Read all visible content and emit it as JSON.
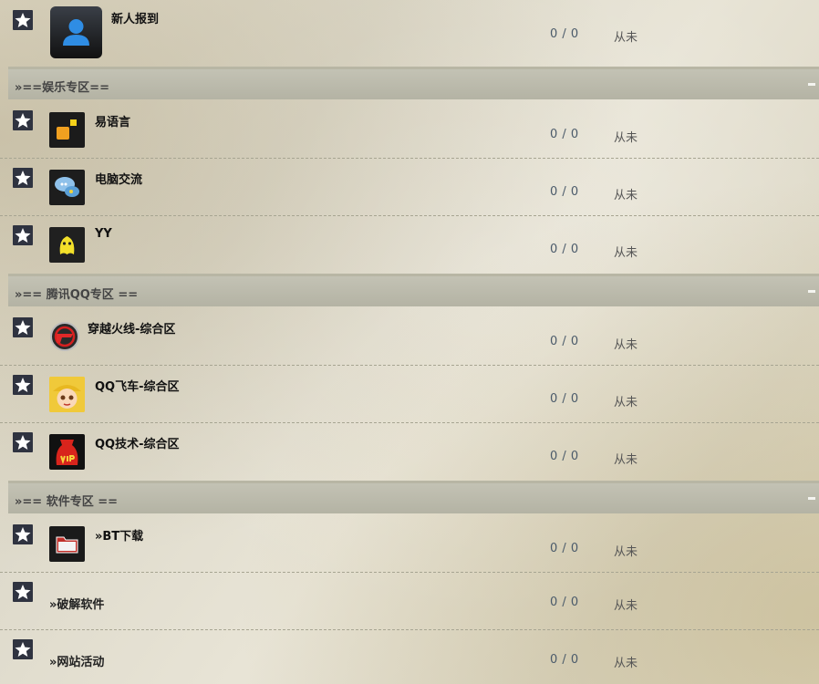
{
  "forum": {
    "top_row": {
      "name": "新人报到",
      "counts": "0 / 0",
      "last": "从未"
    },
    "categories": [
      {
        "title": "»==娱乐专区==",
        "forums": [
          {
            "name": "易语言",
            "counts": "0 / 0",
            "last": "从未",
            "icon": "yi-language-icon"
          },
          {
            "name": "电脑交流",
            "counts": "0 / 0",
            "last": "从未",
            "icon": "chat-bubbles-icon"
          },
          {
            "name": "YY",
            "counts": "0 / 0",
            "last": "从未",
            "icon": "yy-mascot-icon"
          }
        ]
      },
      {
        "title": "»== 腾讯QQ专区 ==",
        "forums": [
          {
            "name": "穿越火线-综合区",
            "counts": "0 / 0",
            "last": "从未",
            "icon": "crossfire-logo-icon"
          },
          {
            "name": "QQ飞车-综合区",
            "counts": "0 / 0",
            "last": "从未",
            "icon": "qq-speed-avatar-icon"
          },
          {
            "name": "QQ技术-综合区",
            "counts": "0 / 0",
            "last": "从未",
            "icon": "vip-bag-icon"
          }
        ]
      },
      {
        "title": "»== 软件专区 ==",
        "forums": [
          {
            "name": "»BT下载",
            "counts": "0 / 0",
            "last": "从未",
            "icon": "folder-icon"
          },
          {
            "name": "»破解软件",
            "counts": "0 / 0",
            "last": "从未"
          },
          {
            "name": "»网站活动",
            "counts": "0 / 0",
            "last": "从未"
          }
        ]
      }
    ]
  },
  "colors": {
    "star_bg": "#2f3340",
    "category_bar": "#bdbcae",
    "counts_text": "#4a5a6a"
  }
}
